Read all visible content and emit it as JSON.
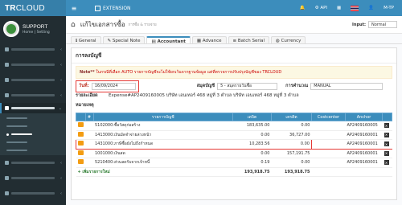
{
  "brand": {
    "prefix": "TR",
    "suffix": "CLOUD"
  },
  "user": {
    "name": "SUPPORT",
    "links": "Home | Setting"
  },
  "navbar": {
    "extension": "EXTENSION",
    "api": "API",
    "user": "M-TP"
  },
  "page": {
    "title": "แก้ไขเอกสารซื้อ",
    "subtitle": "การซื้อ & รายจ่าย",
    "input_label": "Input:",
    "input_value": "Normal"
  },
  "tabs": [
    "General",
    "Special Note",
    "Accountant",
    "Advance",
    "Batch Serial",
    "Currency"
  ],
  "panel_title": "การลงบัญชี",
  "note": {
    "prefix": "Note**",
    "text": "ในกรณีที่เลือก AUTO รายการบัญชีจะไม่ใช้ยกเว้นจากฐานข้อมูล แต่ที่ตรวจการปรับปรุงบัญชีของ TRCLOUD"
  },
  "form": {
    "date_label": "วันที่:",
    "date_value": "16/09/2024",
    "journal_label": "สมุดบัญชี",
    "journal_value": "5 - สมุดรายวันซื้อ",
    "calc_label": "การคำนวณ",
    "calc_value": "MANUAL",
    "desc_label": "รายละเอียด",
    "desc_value": "Expense#AP2409160005 บริษัท เอนเทอร์ 468 หมู่ที่ 3 ตำบล บริษัท เอนเทอร์ 468 หมู่ที่ 3 ตำบล",
    "remark_label": "หมายเหตุ"
  },
  "table": {
    "headers": [
      "",
      "#",
      "รายการบัญชี",
      "เดบิต",
      "เครดิต",
      "Costcenter",
      "Anchor",
      ""
    ],
    "rows": [
      {
        "account": "5102000:ซื้อวัสดุก่อสร้าง",
        "debit": "183,635.00",
        "credit": "0.00",
        "anchor": "AP2409160005"
      },
      {
        "account": "1413000:เงินมัดจำจ่ายล่วงหน้า",
        "debit": "0.00",
        "credit": "36,727.00",
        "anchor": "AP2409160001"
      },
      {
        "account": "1431000:ภาษีซื้อยังไม่ถึงกำหนด",
        "debit": "10,283.56",
        "credit": "0.00",
        "anchor": "AP2409160001"
      },
      {
        "account": "1001000:เงินสด",
        "debit": "0.00",
        "credit": "157,191.75",
        "anchor": "AP2409160001"
      },
      {
        "account": "5210400:ส่วนลดรับจากเจ้าหนี้",
        "debit": "0.19",
        "credit": "0.00",
        "anchor": "AP2409160001"
      }
    ],
    "add_label": "+ เพิ่มรายการใหม่",
    "total_debit": "193,918.75",
    "total_credit": "193,918.75"
  }
}
